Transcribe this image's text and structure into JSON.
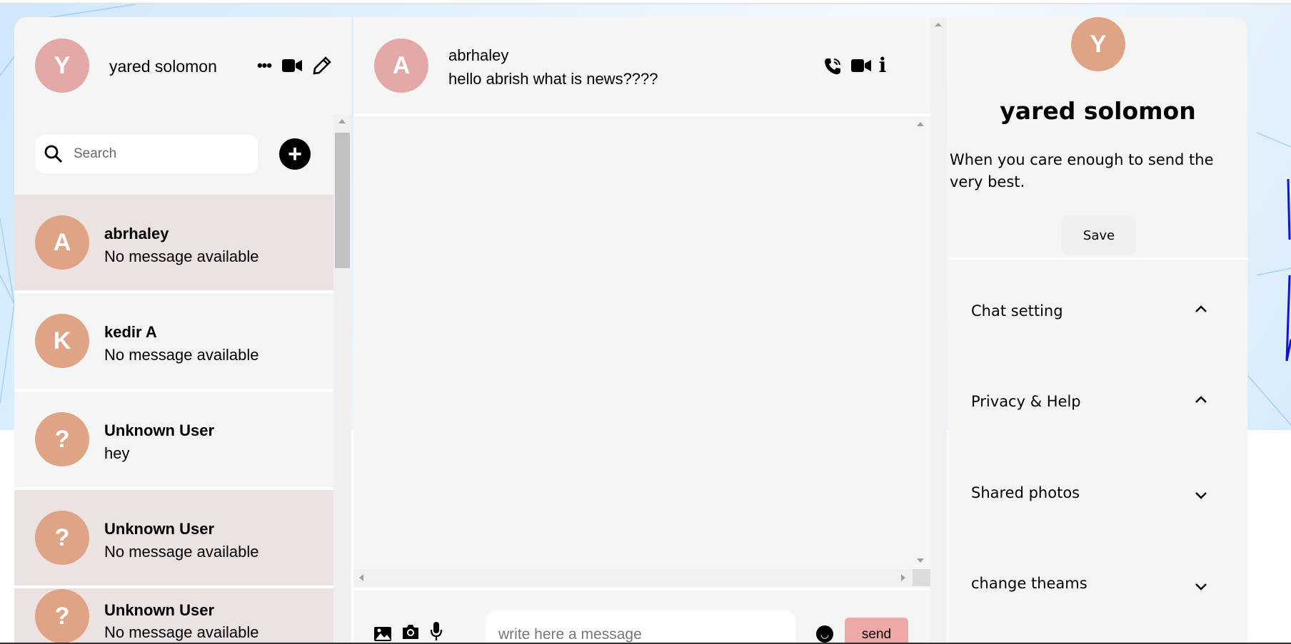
{
  "user": {
    "initial": "Y",
    "name": "yared solomon",
    "bio": "When you care enough to send the very best."
  },
  "sidebar": {
    "search_placeholder": "Search",
    "chats": [
      {
        "initial": "A",
        "name": "abrhaley",
        "message": "No message available",
        "highlight": true
      },
      {
        "initial": "K",
        "name": "kedir A",
        "message": "No message available",
        "highlight": false
      },
      {
        "initial": "?",
        "name": "Unknown User",
        "message": "hey",
        "highlight": false
      },
      {
        "initial": "?",
        "name": "Unknown User",
        "message": "No message available",
        "highlight": true
      },
      {
        "initial": "?",
        "name": "Unknown User",
        "message": "No message available",
        "highlight": true
      }
    ]
  },
  "chat": {
    "initial": "A",
    "name": "abrhaley",
    "last_message": "hello abrish what is news????",
    "input_placeholder": "write here a message",
    "send_label": "send"
  },
  "details": {
    "save_label": "Save",
    "sections": [
      {
        "label": "Chat setting",
        "state": "up"
      },
      {
        "label": "Privacy & Help",
        "state": "up"
      },
      {
        "label": "Shared photos",
        "state": "down"
      },
      {
        "label": "change theams",
        "state": "down"
      }
    ]
  },
  "colors": {
    "avatar_header": "#e2a9a8",
    "avatar": "#dfa386",
    "highlight": "#ece2e1",
    "send": "#f0a8a6"
  }
}
